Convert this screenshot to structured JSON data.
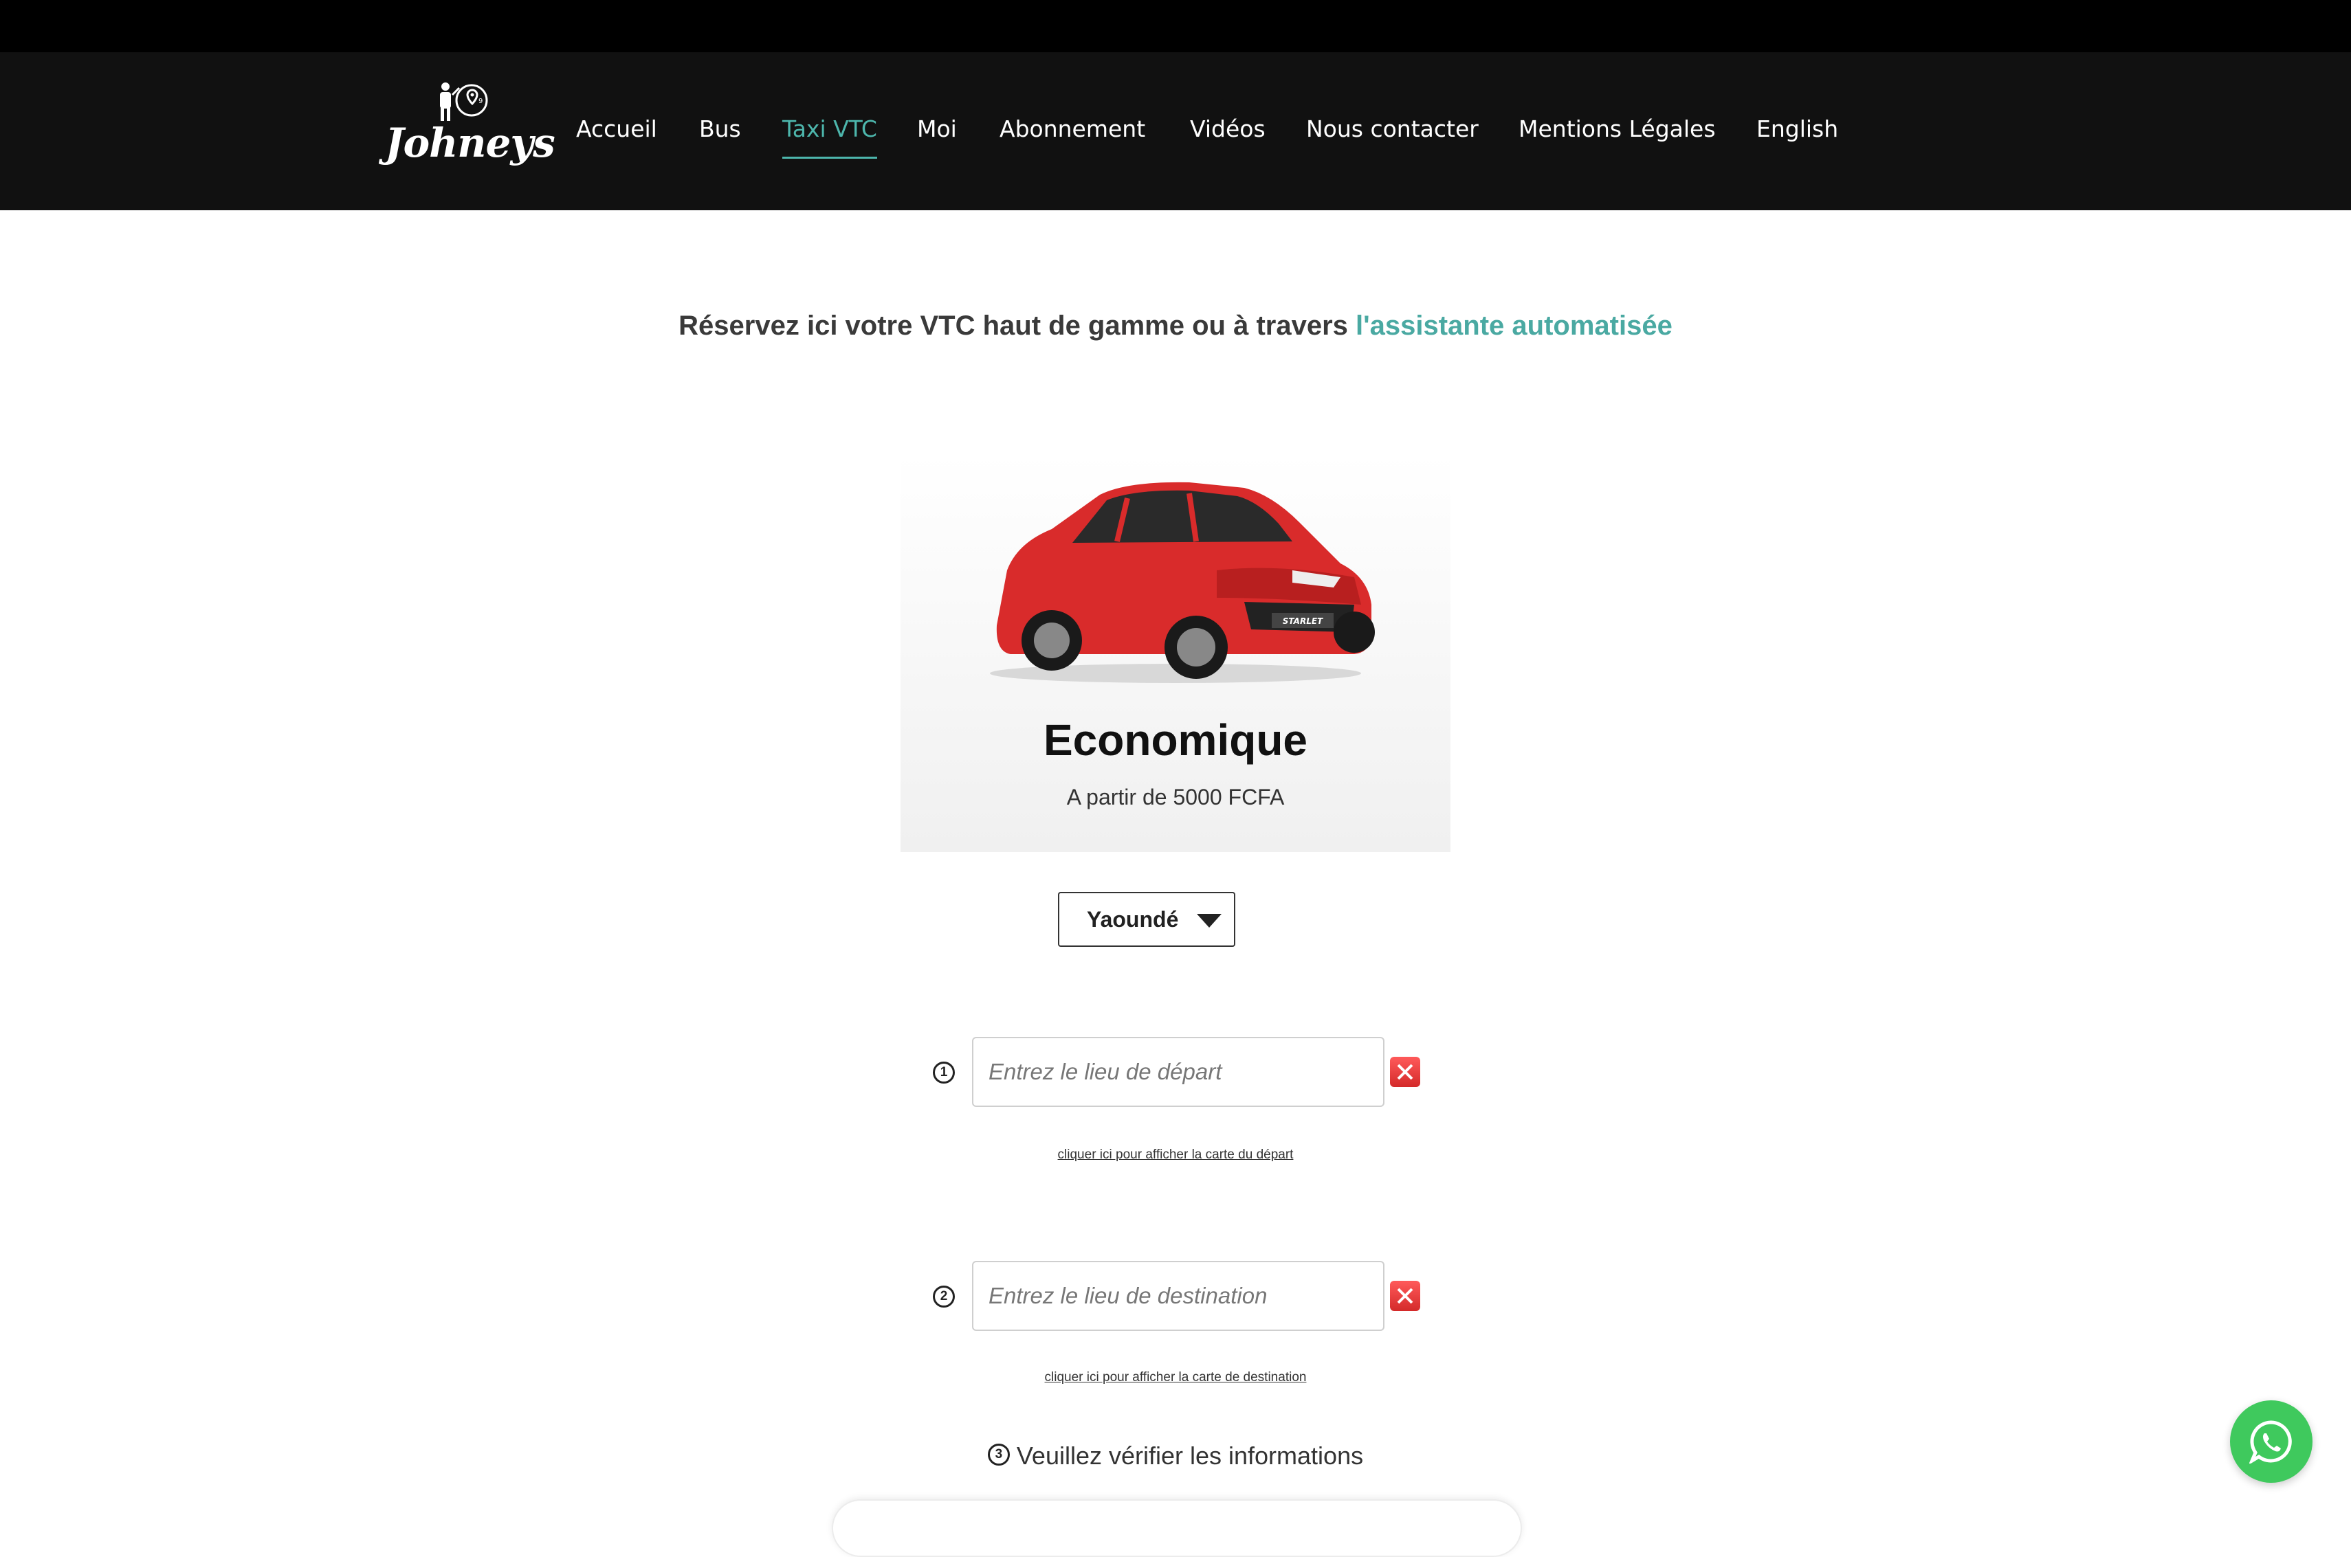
{
  "brand": {
    "name": "Johneys"
  },
  "nav": {
    "items": [
      {
        "label": "Accueil"
      },
      {
        "label": "Bus"
      },
      {
        "label": "Taxi VTC",
        "active": true
      },
      {
        "label": "Moi"
      },
      {
        "label": "Abonnement"
      },
      {
        "label": "Vidéos"
      },
      {
        "label": "Nous contacter"
      },
      {
        "label": "Mentions Légales"
      },
      {
        "label": "English"
      }
    ]
  },
  "headline": {
    "text": "Réservez ici votre VTC haut de gamme ou à travers ",
    "link": "l'assistante automatisée"
  },
  "vehicle": {
    "title": "Economique",
    "price": "A partir de 5000 FCFA",
    "plate": "STARLET",
    "color": "#d92b2b"
  },
  "city": {
    "selected": "Yaoundé"
  },
  "departure": {
    "step": "1",
    "placeholder": "Entrez le lieu de départ",
    "value": "",
    "map_link": "cliquer ici pour afficher la carte du départ"
  },
  "destination": {
    "step": "2",
    "placeholder": "Entrez le lieu de destination",
    "value": "",
    "map_link": "cliquer ici pour afficher la carte de destination"
  },
  "verify": {
    "step": "3",
    "label": "Veuillez vérifier les informations"
  },
  "icons": {
    "clear": "clear-x-icon",
    "chat": "whatsapp-icon",
    "dropdown": "caret-down-icon"
  },
  "colors": {
    "accent": "#4db6ac",
    "navbar": "#111111",
    "clear_button": "#d93a3a",
    "whatsapp": "#3fc95d"
  }
}
